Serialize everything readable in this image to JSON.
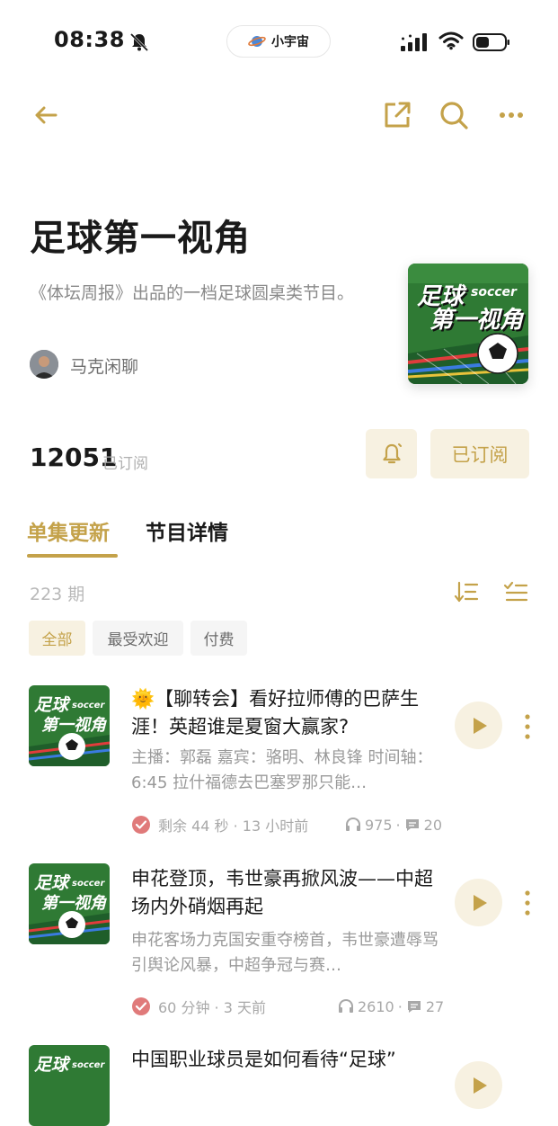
{
  "status_bar": {
    "time": "08:38",
    "center_pill": "小宇宙",
    "icons": [
      "bell-off-icon",
      "signal-icon",
      "wifi-icon",
      "battery-icon"
    ]
  },
  "nav": {
    "icons": [
      "back-arrow-icon",
      "share-icon",
      "search-icon",
      "more-icon"
    ]
  },
  "podcast": {
    "title": "足球第一视角",
    "description": "《体坛周报》出品的一档足球圆桌类节目。",
    "host": "马克闲聊",
    "subscriber_count": "12051",
    "subscriber_label": "已订阅",
    "subscribe_button": "已订阅",
    "cover_text_1": "足球",
    "cover_text_2": "soccer",
    "cover_text_3": "第一视角"
  },
  "tabs": [
    {
      "label": "单集更新",
      "active": true
    },
    {
      "label": "节目详情",
      "active": false
    }
  ],
  "episode_count": "223 期",
  "filters": [
    {
      "label": "全部",
      "active": true
    },
    {
      "label": "最受欢迎",
      "active": false
    },
    {
      "label": "付费",
      "active": false
    }
  ],
  "episodes": [
    {
      "title": "🌞【聊转会】看好拉师傅的巴萨生涯！英超谁是夏窗大赢家?",
      "summary": "主播：郭磊 嘉宾：骆明、林良锋 时间轴： 6:45 拉什福德去巴塞罗那只能…",
      "meta": "剩余 44 秒 · 13 小时前",
      "listens": "975",
      "comments": "20"
    },
    {
      "title": "申花登顶，韦世豪再掀风波——中超场内外硝烟再起",
      "summary": "申花客场力克国安重夺榜首，韦世豪遭辱骂引舆论风暴，中超争冠与赛…",
      "meta": "60 分钟 · 3 天前",
      "listens": "2610",
      "comments": "27"
    },
    {
      "title": "中国职业球员是如何看待“足球”",
      "summary": "",
      "meta": "",
      "listens": "",
      "comments": ""
    }
  ],
  "colors": {
    "accent": "#c4a24a",
    "accent_bg": "#f7f1e1",
    "cover_green": "#2f7a34"
  }
}
